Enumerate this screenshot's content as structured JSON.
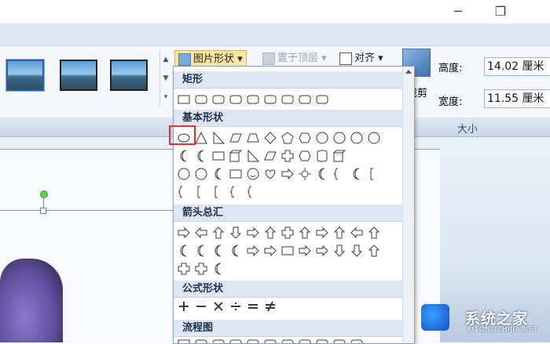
{
  "window": {
    "minimize_icon": "minimize-icon",
    "restore_icon": "restore-icon"
  },
  "ribbon": {
    "picture_shape_label": "图片形状",
    "bring_forward_label": "置于顶层",
    "align_label": "对齐",
    "crop_label": "裁剪",
    "height_label": "高度:",
    "height_value": "14.02 厘米",
    "width_label": "宽度:",
    "width_value": "11.55 厘米",
    "size_group_label": "大小"
  },
  "menu": {
    "sections": [
      {
        "label": "矩形"
      },
      {
        "label": "基本形状"
      },
      {
        "label": "箭头总汇"
      },
      {
        "label": "公式形状"
      },
      {
        "label": "流程图"
      }
    ]
  },
  "watermark": {
    "title": "系统之家",
    "subtitle": "XITONGZHIJIA.NET"
  },
  "colors": {
    "highlight": "#e03030",
    "ribbon": "#dfe7f3",
    "menu_header": "#dde7f4"
  }
}
